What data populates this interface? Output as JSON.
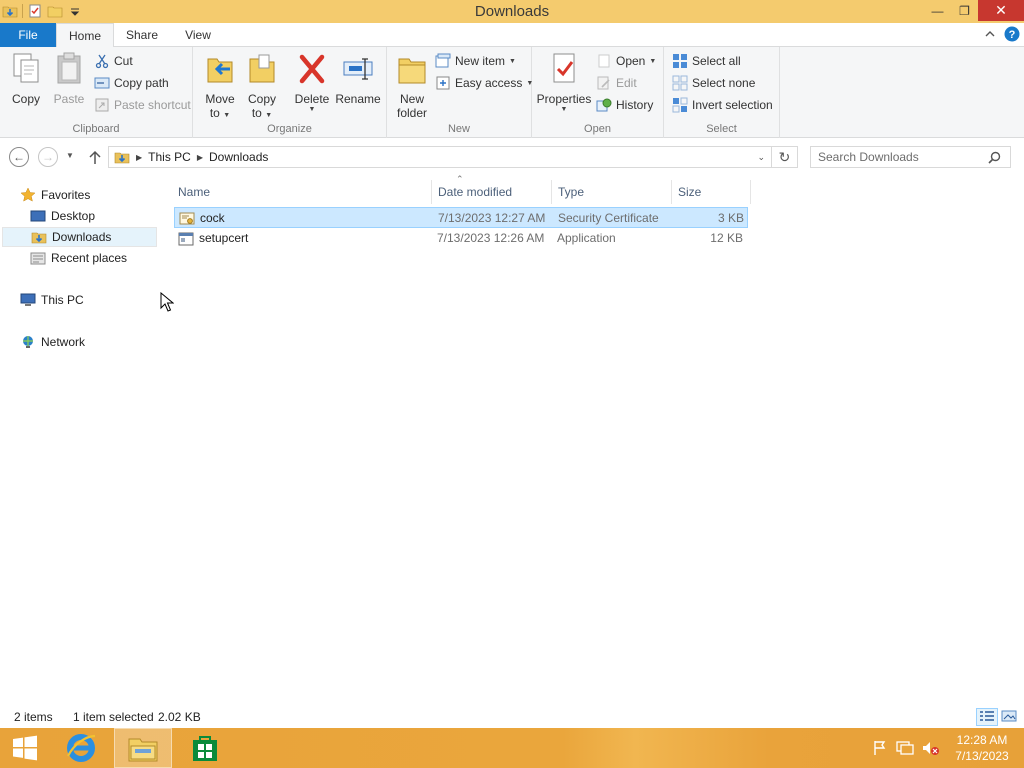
{
  "window": {
    "title": "Downloads"
  },
  "ribbon_tabs": {
    "file": "File",
    "home": "Home",
    "share": "Share",
    "view": "View"
  },
  "ribbon": {
    "clipboard": {
      "label": "Clipboard",
      "copy": "Copy",
      "paste": "Paste",
      "cut": "Cut",
      "copy_path": "Copy path",
      "paste_shortcut": "Paste shortcut"
    },
    "organize": {
      "label": "Organize",
      "move_to": "Move",
      "move_to_2": "to",
      "copy_to": "Copy",
      "copy_to_2": "to",
      "delete": "Delete",
      "rename": "Rename"
    },
    "new": {
      "label": "New",
      "new_folder": "New",
      "new_folder_2": "folder",
      "new_item": "New item",
      "easy_access": "Easy access"
    },
    "open": {
      "label": "Open",
      "properties": "Properties",
      "open": "Open",
      "edit": "Edit",
      "history": "History"
    },
    "select": {
      "label": "Select",
      "select_all": "Select all",
      "select_none": "Select none",
      "invert_selection": "Invert selection"
    }
  },
  "address": {
    "crumbs": [
      "This PC",
      "Downloads"
    ]
  },
  "search": {
    "placeholder": "Search Downloads"
  },
  "nav_pane": {
    "favorites": "Favorites",
    "desktop": "Desktop",
    "downloads": "Downloads",
    "recent_places": "Recent places",
    "this_pc": "This PC",
    "network": "Network"
  },
  "columns": {
    "name": "Name",
    "date_modified": "Date modified",
    "type": "Type",
    "size": "Size"
  },
  "files": [
    {
      "name": "cock",
      "date_modified": "7/13/2023 12:27 AM",
      "type": "Security Certificate",
      "size": "3 KB",
      "icon": "certificate-icon",
      "selected": true
    },
    {
      "name": "setupcert",
      "date_modified": "7/13/2023 12:26 AM",
      "type": "Application",
      "size": "12 KB",
      "icon": "application-icon",
      "selected": false
    }
  ],
  "status": {
    "items": "2 items",
    "selected": "1 item selected",
    "selected_size": "2.02 KB"
  },
  "taskbar": {
    "time": "12:28 AM",
    "date": "7/13/2023"
  },
  "colors": {
    "file_tab": "#1979ca",
    "titlebar": "#f4cb6e",
    "taskbar": "#e8a33a",
    "selection": "#cce8ff",
    "close": "#c7372f"
  }
}
